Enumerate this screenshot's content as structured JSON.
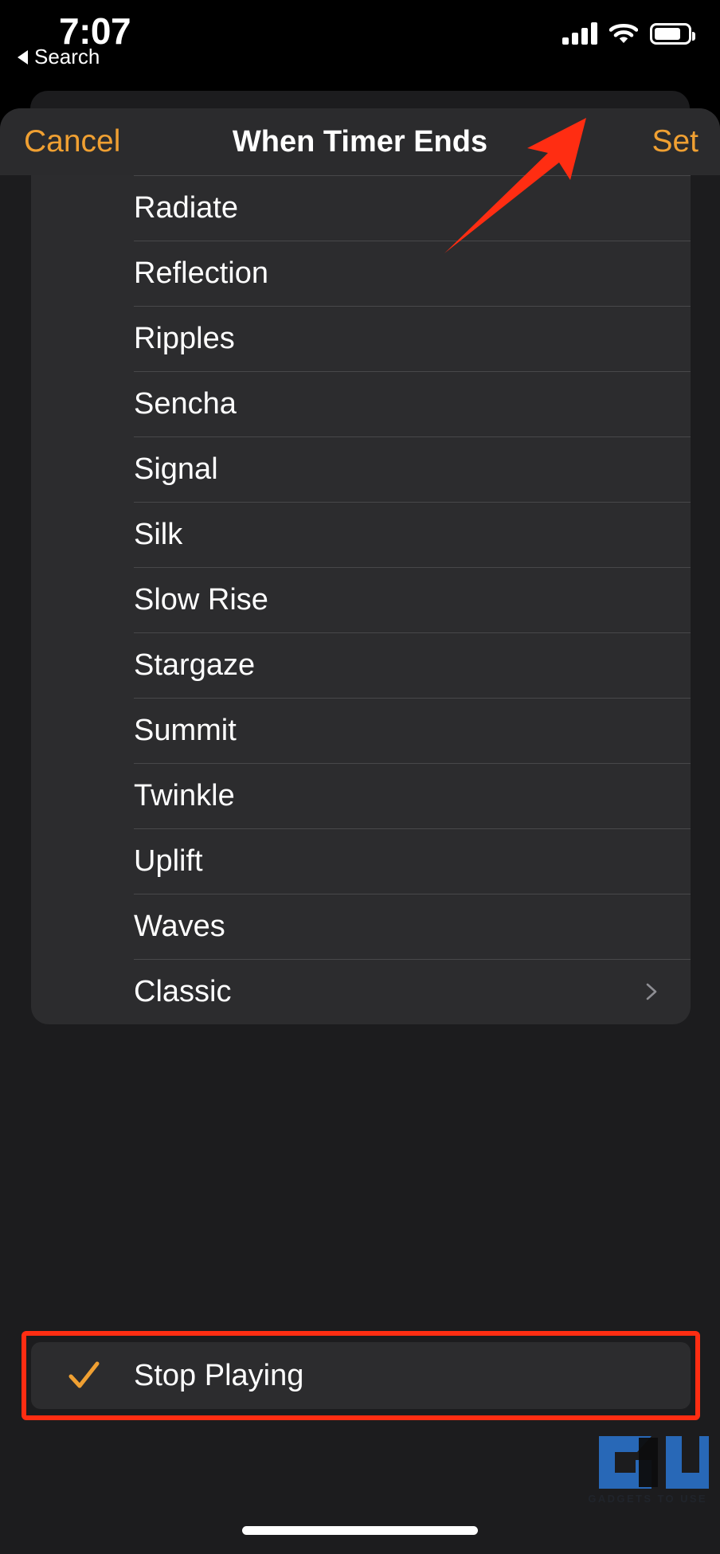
{
  "status_bar": {
    "time": "7:07",
    "back_label": "Search",
    "signal_icon": "cellular-signal-icon",
    "wifi_icon": "wifi-icon",
    "battery_icon": "battery-icon",
    "battery_level_percent": 70
  },
  "sheet": {
    "cancel_label": "Cancel",
    "title": "When Timer Ends",
    "set_label": "Set",
    "accent_color": "#F0A032"
  },
  "tone_list": {
    "items": [
      {
        "label": "Radiate",
        "has_chevron": false
      },
      {
        "label": "Reflection",
        "has_chevron": false
      },
      {
        "label": "Ripples",
        "has_chevron": false
      },
      {
        "label": "Sencha",
        "has_chevron": false
      },
      {
        "label": "Signal",
        "has_chevron": false
      },
      {
        "label": "Silk",
        "has_chevron": false
      },
      {
        "label": "Slow Rise",
        "has_chevron": false
      },
      {
        "label": "Stargaze",
        "has_chevron": false
      },
      {
        "label": "Summit",
        "has_chevron": false
      },
      {
        "label": "Twinkle",
        "has_chevron": false
      },
      {
        "label": "Uplift",
        "has_chevron": false
      },
      {
        "label": "Waves",
        "has_chevron": false
      },
      {
        "label": "Classic",
        "has_chevron": true
      }
    ]
  },
  "stop_playing": {
    "label": "Stop Playing",
    "selected": true,
    "checkmark_icon": "checkmark-icon",
    "checkmark_color": "#F0A032",
    "highlight_color": "#FF2D12"
  },
  "annotations": {
    "arrow_color": "#FF2D12",
    "arrow_points_to": "Set"
  },
  "watermark": {
    "logo_text": "GU",
    "caption": "GADGETS TO USE",
    "logo_color": "#2A6FC4"
  },
  "home_indicator": {
    "label": "home-indicator"
  }
}
